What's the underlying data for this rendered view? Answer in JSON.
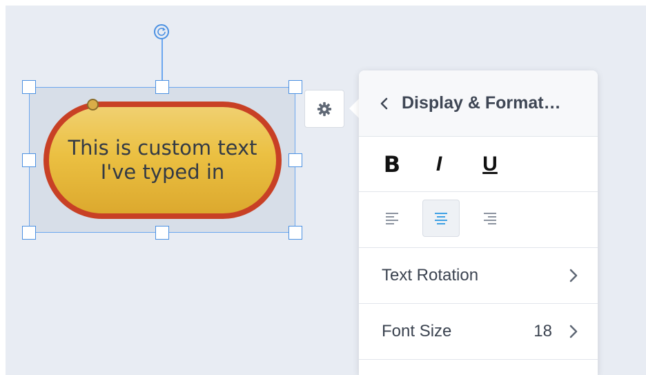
{
  "canvas": {
    "shape_text": "This is custom text\nI've typed in",
    "colors": {
      "background": "#e8ecf3",
      "shape_fill": "#ebc042",
      "shape_border": "#c84025",
      "selection": "#4a90e2"
    }
  },
  "panel": {
    "title": "Display & Format…",
    "style_buttons": {
      "bold": "B",
      "italic": "I",
      "underline": "U"
    },
    "alignment_selected": "center",
    "items": [
      {
        "label": "Text Rotation",
        "value": ""
      },
      {
        "label": "Font Size",
        "value": "18"
      }
    ]
  },
  "icons": [
    "rotate-icon",
    "gear-icon",
    "back-chevron-icon",
    "align-left-icon",
    "align-center-icon",
    "align-right-icon",
    "chevron-right-icon"
  ]
}
